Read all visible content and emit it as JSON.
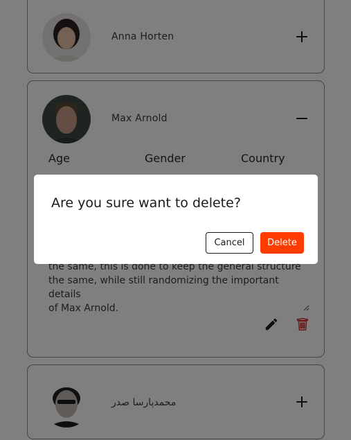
{
  "users": [
    {
      "name": "Anna Horten",
      "toggle_icon": "plus-icon"
    },
    {
      "name": "Max Arnold",
      "toggle_icon": "minus-icon",
      "labels": {
        "age": "Age",
        "gender": "Gender",
        "country": "Country"
      },
      "description_lines": [
        "the same, this is done to keep the general structure",
        "the same, while still randomizing the important details",
        "of Max Arnold."
      ],
      "edit_icon": "pencil-icon",
      "delete_icon": "trash-icon"
    },
    {
      "name": "محمدپارسا صدر",
      "toggle_icon": "plus-icon"
    }
  ],
  "dialog": {
    "title": "Are you sure want to delete?",
    "cancel_label": "Cancel",
    "delete_label": "Delete"
  },
  "colors": {
    "accent": "#ff3d00",
    "delete_icon": "#d32f2f",
    "overlay": "rgba(0,0,0,0.5)"
  }
}
